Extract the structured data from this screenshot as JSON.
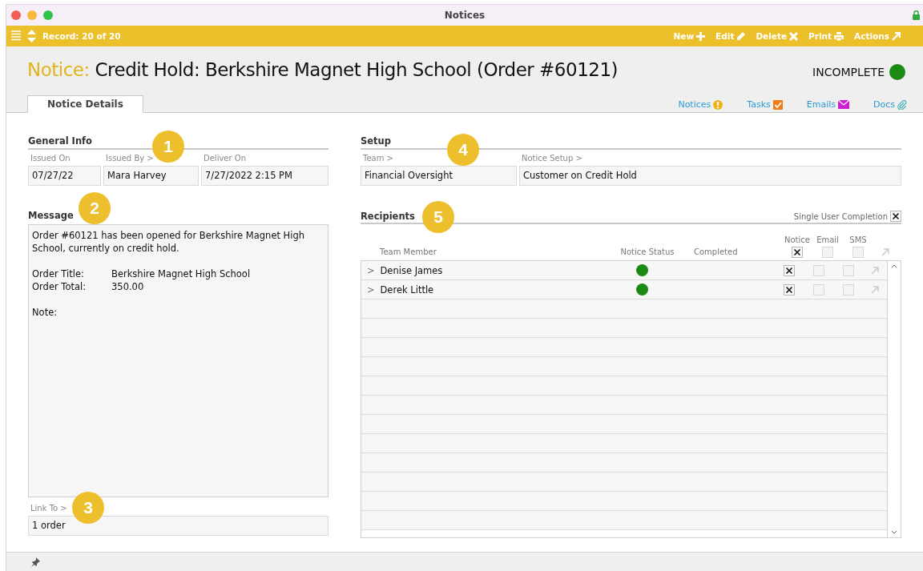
{
  "window": {
    "title": "Notices"
  },
  "toolbar": {
    "record": "Record: 20 of 20",
    "actions": [
      {
        "label": "New",
        "kind": "plus"
      },
      {
        "label": "Edit",
        "kind": "pencil"
      },
      {
        "label": "Delete",
        "kind": "cross"
      },
      {
        "label": "Print",
        "kind": "printer"
      },
      {
        "label": "Actions",
        "kind": "arrow"
      }
    ]
  },
  "header": {
    "prefix": "Notice:",
    "title": "Credit Hold: Berkshire Magnet High School (Order #60121)",
    "status": {
      "label": "INCOMPLETE",
      "color": "#1a8a12"
    }
  },
  "tabs": [
    {
      "label": "Notice Details",
      "selected": true
    }
  ],
  "links": [
    {
      "label": "Notices",
      "kind": "alert"
    },
    {
      "label": "Tasks",
      "kind": "task"
    },
    {
      "label": "Emails",
      "kind": "mail"
    },
    {
      "label": "Docs",
      "kind": "clip"
    }
  ],
  "general_info": {
    "heading": "General Info",
    "callout": "1",
    "fields": [
      {
        "label": "Issued On",
        "value": "07/27/22"
      },
      {
        "label": "Issued By >",
        "value": "Mara Harvey"
      },
      {
        "label": "Deliver On",
        "value": "7/27/2022 2:15 PM"
      }
    ]
  },
  "message": {
    "heading": "Message",
    "callout": "2",
    "paragraph": "Order #60121 has been opened for Berkshire Magnet High School, currently on credit hold.",
    "fields": [
      {
        "label": "Order Title:",
        "value": "Berkshire Magnet High School"
      },
      {
        "label": "Order Total:",
        "value": "350.00"
      }
    ],
    "note": "Note:"
  },
  "link_to": {
    "label": "Link To >",
    "callout": "3",
    "value": "1 order"
  },
  "setup": {
    "heading": "Setup",
    "callout": "4",
    "fields": [
      {
        "label": "Team >",
        "value": "Financial Oversight"
      },
      {
        "label": "Notice Setup >",
        "value": "Customer on Credit Hold"
      }
    ]
  },
  "recipients": {
    "heading": "Recipients",
    "callout": "5",
    "single_user": {
      "label": "Single User Completion",
      "checked": true
    },
    "columns": [
      "Team Member",
      "Notice Status",
      "Completed",
      "Notice",
      "Email",
      "SMS"
    ],
    "header_checks": {
      "notice": true,
      "email": false,
      "sms": false
    },
    "rows": [
      {
        "expander": ">",
        "name": "Denise James",
        "color": "#1a8a12",
        "notice": true,
        "email": false,
        "sms": false
      },
      {
        "expander": ">",
        "name": "Derek Little",
        "color": "#1a8a12",
        "notice": true,
        "email": false,
        "sms": false
      }
    ]
  }
}
